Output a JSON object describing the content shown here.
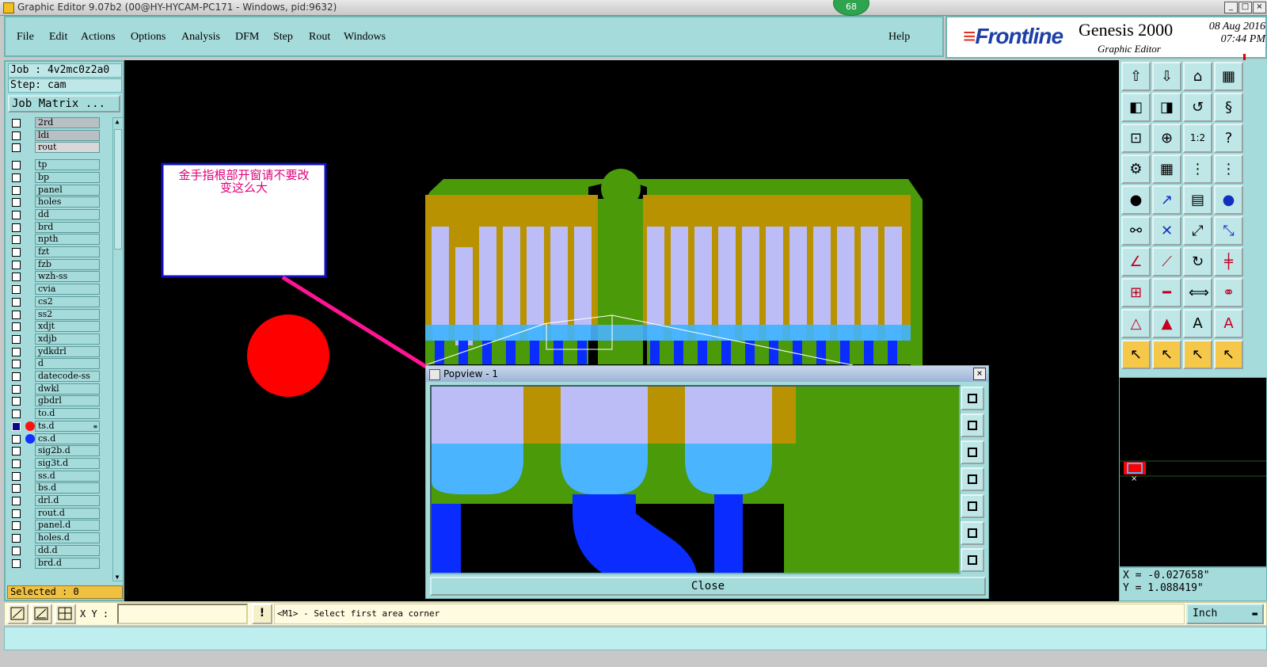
{
  "window": {
    "title": "Graphic Editor 9.07b2 (00@HY-HYCAM-PC171 - Windows, pid:9632)",
    "notification_count": "68",
    "controls": [
      "_",
      "□",
      "×"
    ]
  },
  "menu": {
    "items": [
      "File",
      "Edit",
      "Actions",
      "Options",
      "Analysis",
      "DFM",
      "Step",
      "Rout",
      "Windows"
    ],
    "help": "Help"
  },
  "brand": {
    "logo": "Frontline",
    "product": "Genesis 2000",
    "subtitle": "Graphic Editor",
    "date": "08 Aug 2016",
    "time": "07:44 PM"
  },
  "left_panel": {
    "job": "Job : 4v2mc0z2a0",
    "step": "Step: cam",
    "job_matrix": "Job Matrix ...",
    "selected": "Selected : 0",
    "layers": [
      {
        "name": "2rd",
        "style": "gray"
      },
      {
        "name": "ldi",
        "style": "gray"
      },
      {
        "name": "rout",
        "style": "lgray"
      },
      {
        "name": "tp"
      },
      {
        "name": "bp"
      },
      {
        "name": "panel"
      },
      {
        "name": "holes"
      },
      {
        "name": "dd"
      },
      {
        "name": "brd"
      },
      {
        "name": "npth"
      },
      {
        "name": "fzt"
      },
      {
        "name": "fzb"
      },
      {
        "name": "wzh-ss"
      },
      {
        "name": "cvia"
      },
      {
        "name": "cs2"
      },
      {
        "name": "ss2"
      },
      {
        "name": "xdjt"
      },
      {
        "name": "xdjb"
      },
      {
        "name": "ydkdrl"
      },
      {
        "name": "d"
      },
      {
        "name": "datecode-ss"
      },
      {
        "name": "dwkl"
      },
      {
        "name": "gbdrl"
      },
      {
        "name": "to.d"
      },
      {
        "name": "ts.d",
        "selected": true,
        "dot": "#ff1010",
        "marker": "≡"
      },
      {
        "name": "cs.d",
        "dot": "#1030ff"
      },
      {
        "name": "sig2b.d"
      },
      {
        "name": "sig3t.d"
      },
      {
        "name": "ss.d"
      },
      {
        "name": "bs.d"
      },
      {
        "name": "drl.d"
      },
      {
        "name": "rout.d"
      },
      {
        "name": "panel.d"
      },
      {
        "name": "holes.d"
      },
      {
        "name": "dd.d"
      },
      {
        "name": "brd.d"
      }
    ]
  },
  "canvas": {
    "annotation_line1": "金手指根部开窗请不要改",
    "annotation_line2": "变这么大"
  },
  "popview": {
    "title": "Popview - 1",
    "close_label": "Close"
  },
  "coordinates": {
    "x": "X = -0.027658\"",
    "y": "Y = 1.088419\""
  },
  "bottom": {
    "xy_label": "X Y :",
    "xy_value": "",
    "excl": "!",
    "prompt": "<M1> - Select first area corner",
    "unit": "Inch"
  },
  "right_tools": [
    "layer-up-icon",
    "layer-down-icon",
    "home-icon",
    "grid-icon",
    "pan-left-icon",
    "pan-right-icon",
    "zoom-back-icon",
    "snake-icon",
    "fit-icon",
    "zoom-in-icon",
    "one-to-one-icon",
    "help-icon",
    "measure-icon",
    "grid-toggle-icon",
    "net-icon",
    "net-alt-icon",
    "pad-icon",
    "line-icon",
    "ruler-icon",
    "circle-icon",
    "connect-icon",
    "cross-icon",
    "move-point-icon",
    "arc-icon",
    "angle-icon",
    "slash-icon",
    "rotate-icon",
    "align-icon",
    "copy-icon",
    "cut-line-icon",
    "stretch-icon",
    "join-icon",
    "triangle-icon",
    "triangle-up-icon",
    "triangle-a-icon",
    "triangle-b-icon",
    "select-icon",
    "select-frame-icon",
    "select-edge-icon",
    "select-net-icon"
  ],
  "colors": {
    "panel_bg": "#a6dbdb",
    "board_green": "#4a9a0a",
    "gold": "#b89200",
    "lavender": "#bcbcf6",
    "cyan": "#4ab4ff",
    "blue": "#0a2cff",
    "red": "#ff0000",
    "arrow": "#ff1493",
    "annotation_text": "#e0007a"
  }
}
